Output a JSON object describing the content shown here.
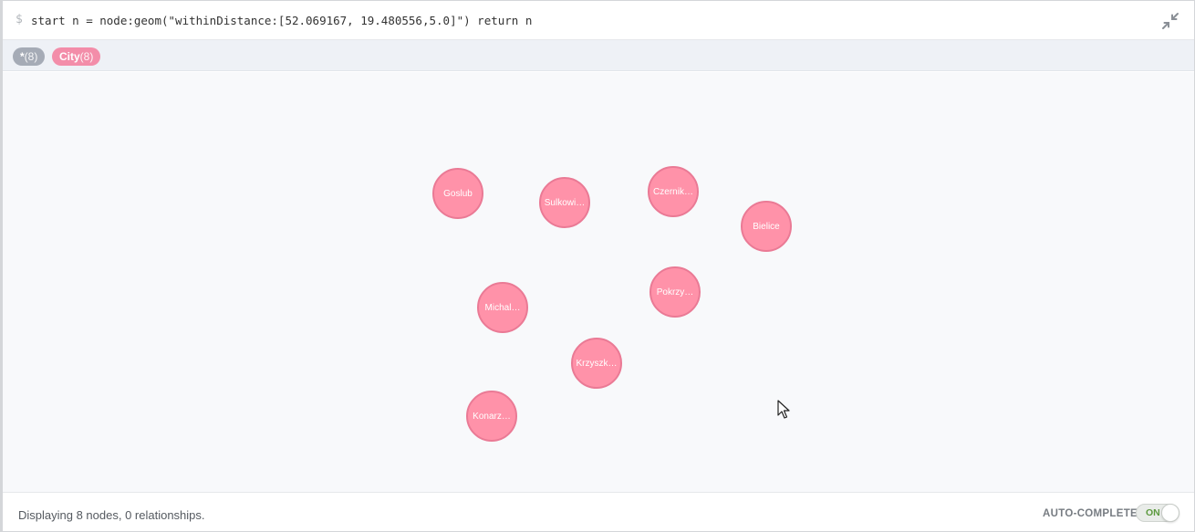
{
  "query": {
    "prompt": "$",
    "text": "start n = node:geom(\"withinDistance:[52.069167, 19.480556,5.0]\") return n"
  },
  "labels": [
    {
      "name": "*",
      "count": "(8)",
      "color": "#a5abb6"
    },
    {
      "name": "City",
      "count": "(8)",
      "color": "#f38da9"
    }
  ],
  "nodes": [
    {
      "label": "Goslub"
    },
    {
      "label": "Sulkowi…"
    },
    {
      "label": "Czernik…"
    },
    {
      "label": "Bielice"
    },
    {
      "label": "Pokrzy…"
    },
    {
      "label": "Michal…"
    },
    {
      "label": "Krzyszk…"
    },
    {
      "label": "Konarz…"
    }
  ],
  "status": {
    "text": "Displaying 8 nodes, 0 relationships.",
    "autocomplete_label": "AUTO-COMPLETE",
    "autocomplete_state": "ON"
  },
  "colors": {
    "node_fill": "#ff92a9",
    "node_border": "#ea7a95",
    "accent_on": "#5c9a3f"
  },
  "icons": {
    "collapse": "collapse-arrows-icon",
    "cursor": "mouse-pointer-icon"
  }
}
